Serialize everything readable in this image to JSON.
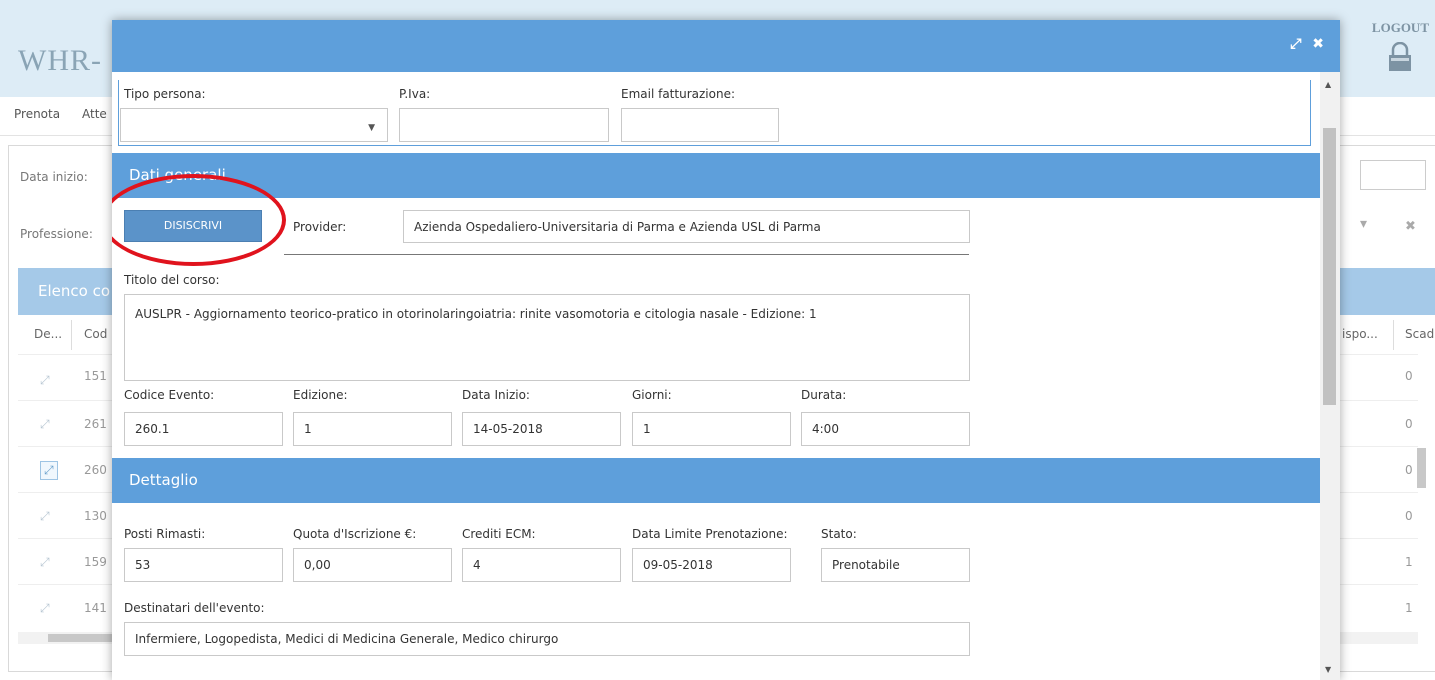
{
  "background": {
    "logo": "WHR-",
    "logout": "LOGOUT",
    "nav": [
      "Prenota",
      "Atte"
    ],
    "filters": {
      "data_inizio": "Data inizio:",
      "professione": "Professione:"
    },
    "list_title": "Elenco co",
    "columns": [
      "De...",
      "Cod",
      "ispo...",
      "Scad"
    ],
    "rows": [
      {
        "code": "151",
        "value": "0"
      },
      {
        "code": "261",
        "value": "0"
      },
      {
        "code": "260",
        "value": "0"
      },
      {
        "code": "130",
        "value": "0"
      },
      {
        "code": "159",
        "value": "1"
      },
      {
        "code": "141",
        "value": "1"
      }
    ]
  },
  "modal": {
    "top_fields": {
      "tipo_persona": {
        "label": "Tipo persona:",
        "value": ""
      },
      "piva": {
        "label": "P.Iva:",
        "value": ""
      },
      "email": {
        "label": "Email fatturazione:",
        "value": ""
      }
    },
    "dati_generali": {
      "title": "Dati generali",
      "disiscrivi_label": "DISISCRIVI",
      "provider_label": "Provider:",
      "provider_value": "Azienda Ospedaliero-Universitaria di Parma e Azienda USL di Parma",
      "titolo_label": "Titolo del corso:",
      "titolo_value": "AUSLPR - Aggiornamento teorico-pratico in otorinolaringoiatria: rinite vasomotoria e citologia nasale - Edizione: 1",
      "codice_evento": {
        "label": "Codice Evento:",
        "value": "260.1"
      },
      "edizione": {
        "label": "Edizione:",
        "value": "1"
      },
      "data_inizio": {
        "label": "Data Inizio:",
        "value": "14-05-2018"
      },
      "giorni": {
        "label": "Giorni:",
        "value": "1"
      },
      "durata": {
        "label": "Durata:",
        "value": "4:00"
      }
    },
    "dettaglio": {
      "title": "Dettaglio",
      "posti": {
        "label": "Posti Rimasti:",
        "value": "53"
      },
      "quota": {
        "label": "Quota d'Iscrizione €:",
        "value": "0,00"
      },
      "crediti": {
        "label": "Crediti ECM:",
        "value": "4"
      },
      "data_limite": {
        "label": "Data Limite Prenotazione:",
        "value": "09-05-2018"
      },
      "stato": {
        "label": "Stato:",
        "value": "Prenotabile"
      },
      "destinatari_label": "Destinatari dell'evento:",
      "destinatari_value": "Infermiere, Logopedista, Medici di Medicina Generale, Medico chirurgo"
    }
  },
  "colors": {
    "accent": "#5e9fdb",
    "highlight": "#e0131d"
  }
}
